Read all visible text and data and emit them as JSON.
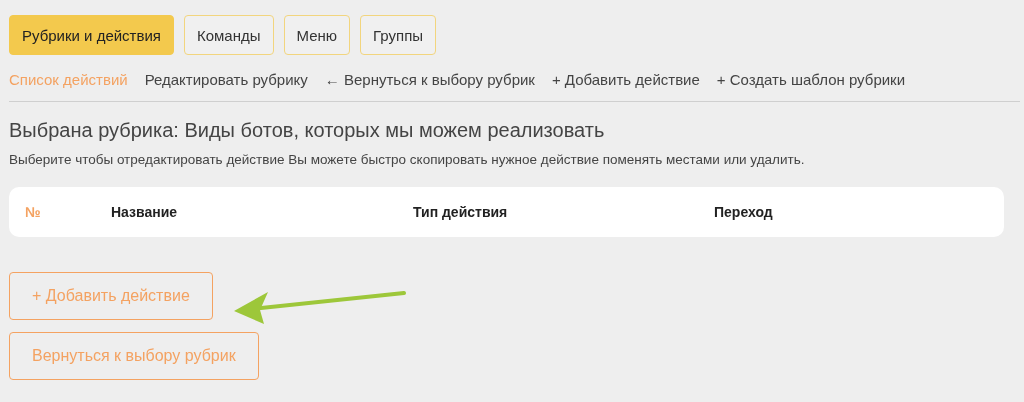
{
  "tabs": [
    {
      "label": "Рубрики и действия",
      "selected": true
    },
    {
      "label": "Команды",
      "selected": false
    },
    {
      "label": "Меню",
      "selected": false
    },
    {
      "label": "Группы",
      "selected": false
    }
  ],
  "subnav": [
    {
      "label": "Список действий",
      "selected": true
    },
    {
      "label": "Редактировать рубрику",
      "selected": false
    },
    {
      "label": "← Вернуться к выбору рубрик",
      "selected": false
    },
    {
      "label": "+ Добавить действие",
      "selected": false
    },
    {
      "label": "+ Создать шаблон рубрики",
      "selected": false
    }
  ],
  "heading": "Выбрана рубрика: Виды ботов, которых мы можем реализовать",
  "description": "Выберите чтобы отредактировать действие Вы можете быстро скопировать нужное действие поменять местами или удалить.",
  "table": {
    "columns": [
      "№",
      "Название",
      "Тип действия",
      "Переход"
    ]
  },
  "buttons": [
    "+ Добавить действие",
    "Вернуться к выбору рубрик"
  ]
}
